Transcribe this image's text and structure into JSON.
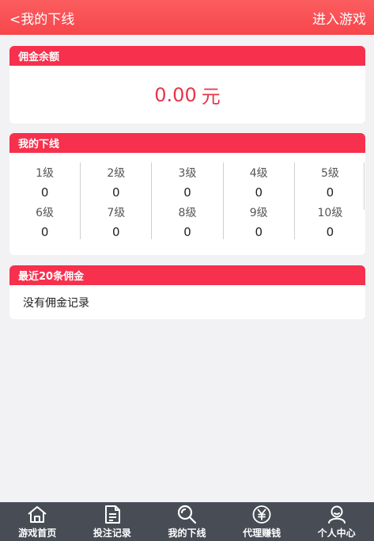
{
  "header": {
    "back_label": "<我的下线",
    "enter_label": "进入游戏"
  },
  "balance_card": {
    "title": "佣金余额",
    "amount": "0.00",
    "unit": "元"
  },
  "downline_card": {
    "title": "我的下线",
    "levels": [
      {
        "label": "1级",
        "count": "0"
      },
      {
        "label": "2级",
        "count": "0"
      },
      {
        "label": "3级",
        "count": "0"
      },
      {
        "label": "4级",
        "count": "0"
      },
      {
        "label": "5级",
        "count": "0"
      },
      {
        "label": "6级",
        "count": "0"
      },
      {
        "label": "7级",
        "count": "0"
      },
      {
        "label": "8级",
        "count": "0"
      },
      {
        "label": "9级",
        "count": "0"
      },
      {
        "label": "10级",
        "count": "0"
      }
    ]
  },
  "recent_card": {
    "title": "最近20条佣金",
    "empty_text": "没有佣金记录"
  },
  "tabbar": {
    "items": [
      {
        "label": "游戏首页",
        "icon": "home-icon"
      },
      {
        "label": "投注记录",
        "icon": "document-icon"
      },
      {
        "label": "我的下线",
        "icon": "search-icon"
      },
      {
        "label": "代理赚钱",
        "icon": "yuan-coin-icon"
      },
      {
        "label": "个人中心",
        "icon": "user-icon"
      }
    ]
  },
  "colors": {
    "header": "#f7464c",
    "card_head": "#f6304d",
    "amount": "#e8344a",
    "tabbar": "#474c55"
  }
}
